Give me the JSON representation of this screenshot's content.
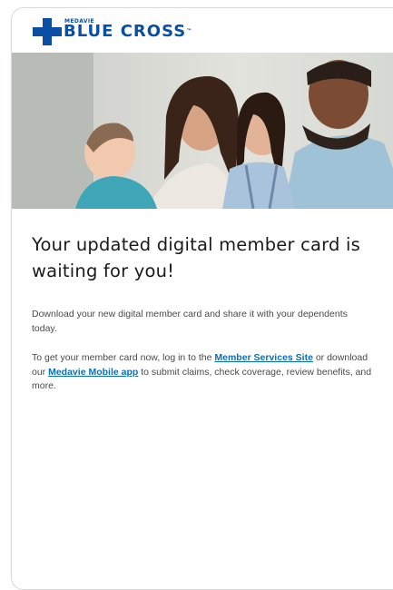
{
  "brand": {
    "name_small": "MEDAVIE",
    "name_large": "BLUE CROSS",
    "trademark": "™",
    "color": "#0a4fa3",
    "logo_icon": "cross-icon"
  },
  "hero": {
    "image_icon": "family-photo"
  },
  "email": {
    "headline": "Your updated digital member card is waiting for you!",
    "paragraph1": "Download your new digital member card and share it with your dependents today.",
    "paragraph2": {
      "text_before_link1": "To get your member card now, log in to the ",
      "link1": "Member Services Site",
      "text_between": " or download our ",
      "link2": "Medavie Mobile app",
      "text_after": " to submit claims, check coverage, review benefits, and more."
    },
    "link_color": "#0a6fb8"
  }
}
